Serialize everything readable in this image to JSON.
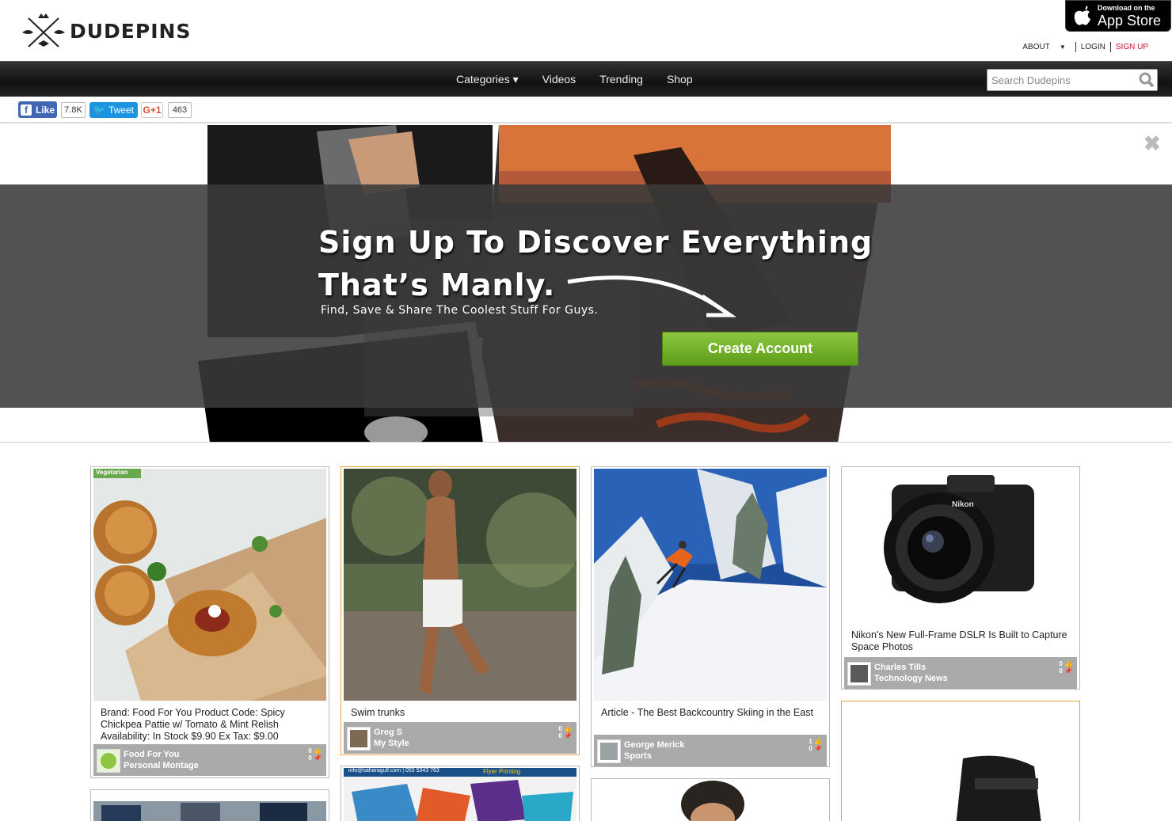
{
  "header": {
    "logo": "DUDEPINS",
    "appstore": {
      "small": "Download on the",
      "big": "App Store"
    },
    "about": "ABOUT",
    "login": "LOGIN",
    "signup": "SIGN UP"
  },
  "nav": {
    "items": [
      "Categories ▾",
      "Videos",
      "Trending",
      "Shop"
    ],
    "search_placeholder": "Search Dudepins"
  },
  "social": {
    "like": "Like",
    "like_count": "7.8K",
    "tweet": "Tweet",
    "gplus": "G+1",
    "gplus_count": "463"
  },
  "banner": {
    "headline1": "Sign Up To Discover Everything",
    "headline2": "That’s Manly.",
    "subhead": "Find, Save & Share The Coolest Stuff For Guys.",
    "cta": "Create Account"
  },
  "cards": [
    {
      "title": "Brand: Food For You Product Code: Spicy Chickpea Pattie w/ Tomato & Mint Relish Availability: In Stock $9.90 Ex Tax: $9.00",
      "user": "Food For You",
      "board": "Personal Montage",
      "likes": "0",
      "pins": "0"
    },
    {
      "title": "Swim trunks",
      "user": "Greg S",
      "board": "My Style",
      "likes": "0",
      "pins": "0"
    },
    {
      "title": "Article - The Best Backcountry Skiing in the East",
      "user": "George Merick",
      "board": "Sports",
      "likes": "1",
      "pins": "0"
    },
    {
      "title": "Nikon's New Full-Frame DSLR Is Built to Capture Space Photos",
      "user": "Charles Tills",
      "board": "Technology News",
      "likes": "0",
      "pins": "0"
    }
  ],
  "flyer": {
    "text": "info@saharagulf.com | 055 5343 763",
    "label": "Flyer Printing"
  },
  "food_tag": "Vegetarian",
  "camera_brand": "Nikon"
}
